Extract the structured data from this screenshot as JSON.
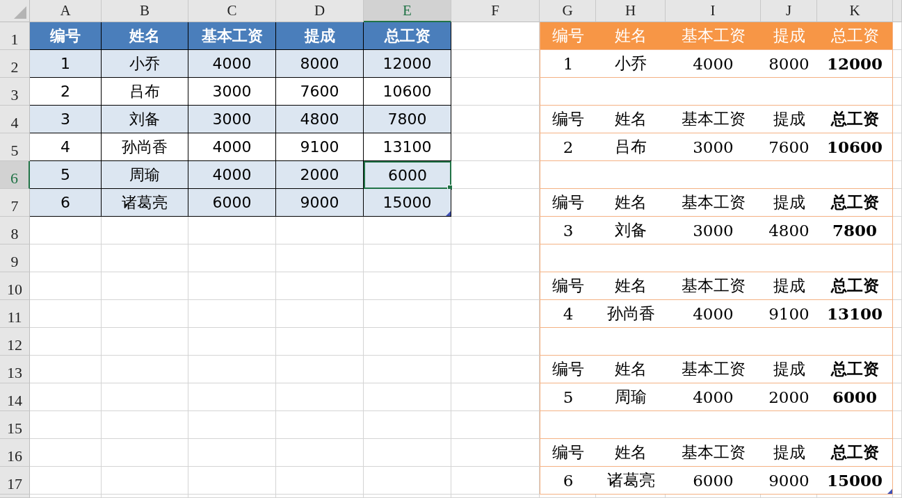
{
  "columns": [
    {
      "label": "A",
      "selected": false
    },
    {
      "label": "B",
      "selected": false
    },
    {
      "label": "C",
      "selected": false
    },
    {
      "label": "D",
      "selected": false
    },
    {
      "label": "E",
      "selected": true
    },
    {
      "label": "F",
      "selected": false
    },
    {
      "label": "G",
      "selected": false
    },
    {
      "label": "H",
      "selected": false
    },
    {
      "label": "I",
      "selected": false
    },
    {
      "label": "J",
      "selected": false
    },
    {
      "label": "K",
      "selected": false
    }
  ],
  "rows": [
    {
      "label": "1",
      "selected": false
    },
    {
      "label": "2",
      "selected": false
    },
    {
      "label": "3",
      "selected": false
    },
    {
      "label": "4",
      "selected": false
    },
    {
      "label": "5",
      "selected": false
    },
    {
      "label": "6",
      "selected": true
    },
    {
      "label": "7",
      "selected": false
    },
    {
      "label": "8",
      "selected": false
    },
    {
      "label": "9",
      "selected": false
    },
    {
      "label": "10",
      "selected": false
    },
    {
      "label": "11",
      "selected": false
    },
    {
      "label": "12",
      "selected": false
    },
    {
      "label": "13",
      "selected": false
    },
    {
      "label": "14",
      "selected": false
    },
    {
      "label": "15",
      "selected": false
    },
    {
      "label": "16",
      "selected": false
    },
    {
      "label": "17",
      "selected": false
    }
  ],
  "salary_table": {
    "header": [
      "编号",
      "姓名",
      "基本工资",
      "提成",
      "总工资"
    ],
    "rows": [
      {
        "cells": [
          "1",
          "小乔",
          "4000",
          "8000",
          "12000"
        ],
        "shaded": true
      },
      {
        "cells": [
          "2",
          "吕布",
          "3000",
          "7600",
          "10600"
        ],
        "shaded": false
      },
      {
        "cells": [
          "3",
          "刘备",
          "3000",
          "4800",
          "7800"
        ],
        "shaded": true
      },
      {
        "cells": [
          "4",
          "孙尚香",
          "4000",
          "9100",
          "13100"
        ],
        "shaded": false
      },
      {
        "cells": [
          "5",
          "周瑜",
          "4000",
          "2000",
          "6000"
        ],
        "shaded": true
      },
      {
        "cells": [
          "6",
          "诸葛亮",
          "6000",
          "9000",
          "15000"
        ],
        "shaded": true
      }
    ]
  },
  "slips": [
    {
      "kind": "filled",
      "header": [
        "编号",
        "姓名",
        "基本工资",
        "提成",
        "总工资"
      ],
      "values": [
        "1",
        "小乔",
        "4000",
        "8000",
        "12000"
      ]
    },
    {
      "kind": "plain",
      "header": [
        "编号",
        "姓名",
        "基本工资",
        "提成",
        "总工资"
      ],
      "values": [
        "2",
        "吕布",
        "3000",
        "7600",
        "10600"
      ]
    },
    {
      "kind": "plain",
      "header": [
        "编号",
        "姓名",
        "基本工资",
        "提成",
        "总工资"
      ],
      "values": [
        "3",
        "刘备",
        "3000",
        "4800",
        "7800"
      ]
    },
    {
      "kind": "plain",
      "header": [
        "编号",
        "姓名",
        "基本工资",
        "提成",
        "总工资"
      ],
      "values": [
        "4",
        "孙尚香",
        "4000",
        "9100",
        "13100"
      ]
    },
    {
      "kind": "plain",
      "header": [
        "编号",
        "姓名",
        "基本工资",
        "提成",
        "总工资"
      ],
      "values": [
        "5",
        "周瑜",
        "4000",
        "2000",
        "6000"
      ]
    },
    {
      "kind": "plain",
      "header": [
        "编号",
        "姓名",
        "基本工资",
        "提成",
        "总工资"
      ],
      "values": [
        "6",
        "诸葛亮",
        "6000",
        "9000",
        "15000"
      ]
    }
  ]
}
